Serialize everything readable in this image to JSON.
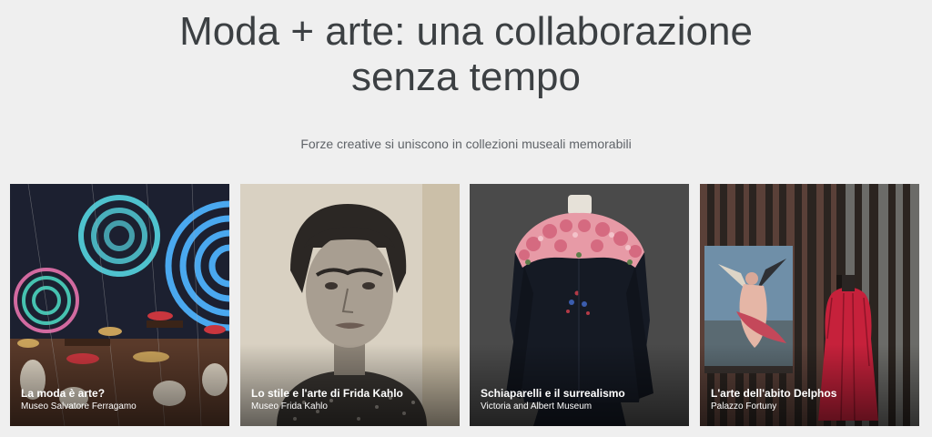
{
  "page": {
    "title_line1": "Moda + arte: una collaborazione",
    "title_line2": "senza tempo",
    "subtitle": "Forze creative si uniscono in collezioni museali memorabili"
  },
  "cards": [
    {
      "title": "La moda è arte?",
      "subtitle": "Museo Salvatore Ferragamo"
    },
    {
      "title": "Lo stile e l'arte di Frida Kahlo",
      "subtitle": "Museo Frida Kahlo"
    },
    {
      "title": "Schiaparelli e il surrealismo",
      "subtitle": "Victoria and Albert Museum"
    },
    {
      "title": "L'arte dell'abito Delphos",
      "subtitle": "Palazzo Fortuny"
    }
  ],
  "colors": {
    "background": "#efefef",
    "title_text": "#3c4043",
    "subtitle_text": "#5f6368"
  }
}
